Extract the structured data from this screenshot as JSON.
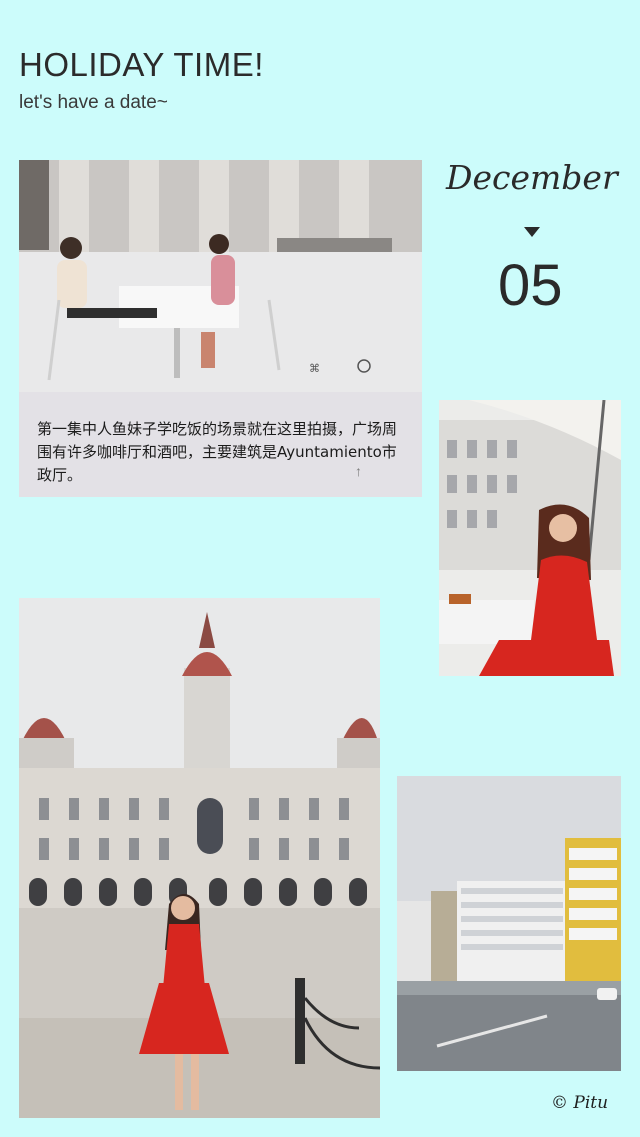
{
  "header": {
    "title": "HOLIDAY TIME!",
    "subtitle": "let's have a date~"
  },
  "date": {
    "month": "December",
    "day": "05",
    "indicator_icon": "triangle-down-icon"
  },
  "photos": [
    {
      "id": "scene-with-caption",
      "caption": "第一集中人鱼妹子学吃饭的场景就在这里拍摄，广场周围有许多咖啡厅和酒吧，主要建筑是Ayuntamiento市政厅。",
      "arrow_icon": "arrow-up-icon",
      "arrow_glyph": "↑"
    },
    {
      "id": "cafe-woman-red-dress"
    },
    {
      "id": "city-hall-plaza-woman-red-dress"
    },
    {
      "id": "street-glass-galleries"
    }
  ],
  "footer": {
    "copyright": "© Pitu"
  },
  "colors": {
    "background": "#ccfcfb",
    "text": "#2b2b2b",
    "dress_red": "#d7261f"
  }
}
